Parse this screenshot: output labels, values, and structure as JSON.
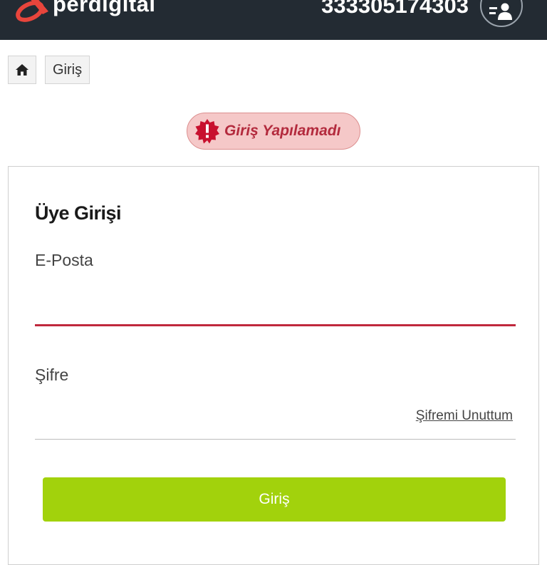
{
  "header": {
    "brand": "perdigital",
    "phone": "333305174303",
    "colors": {
      "bar": "#232b33",
      "logo": "#e8453c"
    }
  },
  "breadcrumb": {
    "home_icon": "home-icon",
    "items": [
      {
        "label": "Giriş"
      }
    ]
  },
  "alert": {
    "icon": "exclamation-badge-icon",
    "message": "Giriş Yapılamadı",
    "colors": {
      "bg": "#f5c8c8",
      "text": "#b32a3d"
    }
  },
  "login_form": {
    "title": "Üye Girişi",
    "email": {
      "label": "E-Posta",
      "value": "",
      "placeholder": ""
    },
    "password": {
      "label": "Şifre",
      "value": "",
      "placeholder": ""
    },
    "forgot_link": "Şifremi Unuttum",
    "submit_label": "Giriş",
    "colors": {
      "submit": "#a2d20c",
      "error_underline": "#c0283d"
    }
  }
}
